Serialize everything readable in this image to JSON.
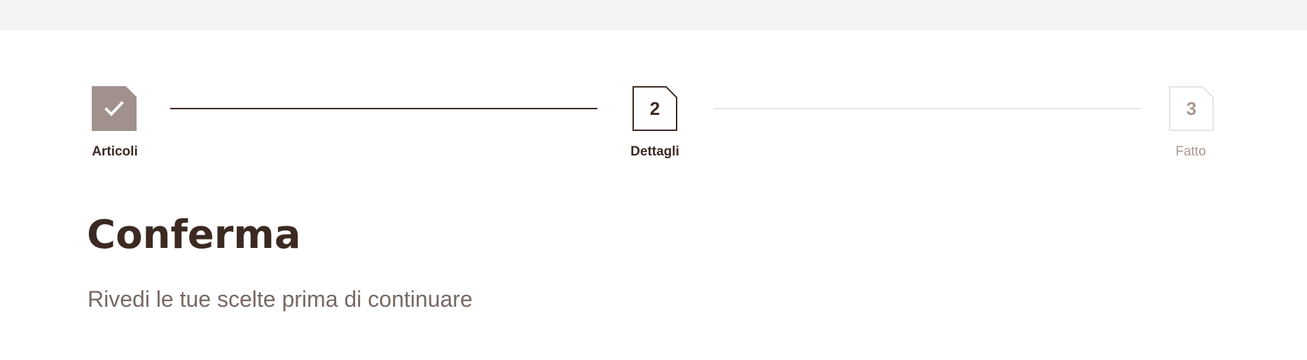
{
  "stepper": {
    "steps": [
      {
        "label": "Articoli",
        "state": "completed",
        "icon": "checkmark-icon"
      },
      {
        "label": "Dettagli",
        "number": "2",
        "state": "current"
      },
      {
        "label": "Fatto",
        "number": "3",
        "state": "upcoming"
      }
    ]
  },
  "page": {
    "title": "Conferma",
    "subtitle": "Rivedi le tue scelte prima di continuare"
  },
  "colors": {
    "dark": "#3b2a22",
    "completed_fill": "#a0918c",
    "muted": "#a8998f",
    "line_inactive": "#e6e3e1",
    "top_bar": "#f4f4f4"
  }
}
